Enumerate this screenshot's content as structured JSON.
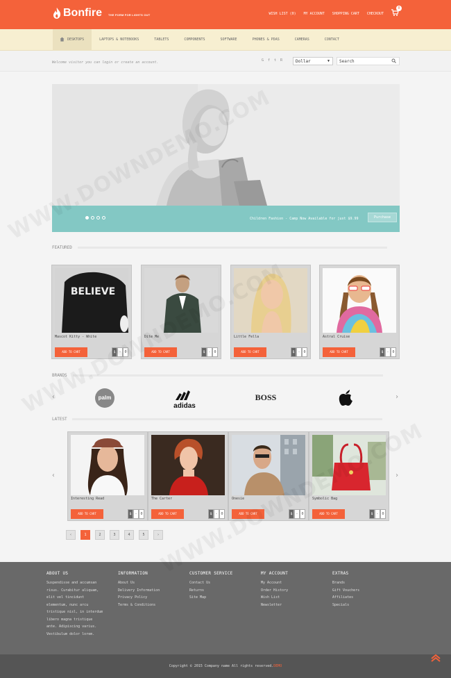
{
  "header": {
    "brand": "Bonfire",
    "tagline": "THE FORM FOR LIGHTS OUT",
    "links": [
      "WISH LIST (0)",
      "MY ACCOUNT",
      "SHOPPING CART",
      "CHECKOUT"
    ],
    "cart_count": "0",
    "brand_color": "#f4623a"
  },
  "nav": {
    "items": [
      "DESKTOPS",
      "LAPTOPS & NOTEBOOKS",
      "TABLETS",
      "COMPONENTS",
      "SOFTWARE",
      "PHONES & PDAS",
      "CAMERAS",
      "CONTACT"
    ]
  },
  "subbar": {
    "welcome": "Welcome visitor you can login or create an account.",
    "social": [
      "G",
      "f",
      "t",
      "R"
    ],
    "currency": "Dollar",
    "search_placeholder": "Search"
  },
  "slider": {
    "caption": "Children Fashion - Camp Now Available for just $9.99",
    "button": "Purchase",
    "slides": 4,
    "active_slide": 1
  },
  "featured": {
    "title": "FEATURED",
    "products": [
      {
        "name": "Mascot Kitty - White",
        "button": "ADD TO CART",
        "counter": [
          "$",
          "-",
          "0"
        ]
      },
      {
        "name": "Dite Me",
        "button": "ADD TO CART",
        "counter": [
          "$",
          "-",
          "0"
        ]
      },
      {
        "name": "Little Fella",
        "button": "ADD TO CART",
        "counter": [
          "$",
          "-",
          "0"
        ]
      },
      {
        "name": "Astral Cruise",
        "button": "ADD TO CART",
        "counter": [
          "$",
          "-",
          "0"
        ]
      }
    ]
  },
  "brands": {
    "title": "BRANDS",
    "items": [
      "palm",
      "adidas",
      "BOSS",
      "apple"
    ]
  },
  "latest": {
    "title": "LATEST",
    "products": [
      {
        "name": "Interesting Read",
        "button": "ADD TO CART",
        "counter": [
          "$",
          "-",
          "0"
        ]
      },
      {
        "name": "The Carter",
        "button": "ADD TO CART",
        "counter": [
          "$",
          "-",
          "0"
        ]
      },
      {
        "name": "Onesie",
        "button": "ADD TO CART",
        "counter": [
          "$",
          "-",
          "0"
        ]
      },
      {
        "name": "Symbolic Bag",
        "button": "ADD TO CART",
        "counter": [
          "$",
          "-",
          "0"
        ]
      }
    ]
  },
  "pagination": {
    "prev": "‹",
    "pages": [
      "1",
      "2",
      "3",
      "4",
      "5"
    ],
    "next": "›",
    "active": "1"
  },
  "footer": {
    "about": {
      "title": "ABOUT US",
      "text": "Suspendisse and accumsan risus. Curabitur aliquam, elit vel tincidunt elementum, nunc arcu tristique nisl, in interdum libero magna tristique ante. Adipiscing varius. Vestibulum dolor lorem."
    },
    "columns": [
      {
        "title": "INFORMATION",
        "links": [
          "About Us",
          "Delivery Information",
          "Privacy Policy",
          "Terms & Conditions"
        ]
      },
      {
        "title": "CUSTOMER SERVICE",
        "links": [
          "Contact Us",
          "Returns",
          "Site Map"
        ]
      },
      {
        "title": "MY ACCOUNT",
        "links": [
          "My Account",
          "Order History",
          "Wish List",
          "Newsletter"
        ]
      },
      {
        "title": "EXTRAS",
        "links": [
          "Brands",
          "Gift Vouchers",
          "Affiliates",
          "Specials"
        ]
      }
    ],
    "copyright": "Copyright © 2015 Company name All rights reserved.",
    "copyright_link": "DEMO"
  },
  "watermark": "WWW.DOWNDEMO.COM"
}
